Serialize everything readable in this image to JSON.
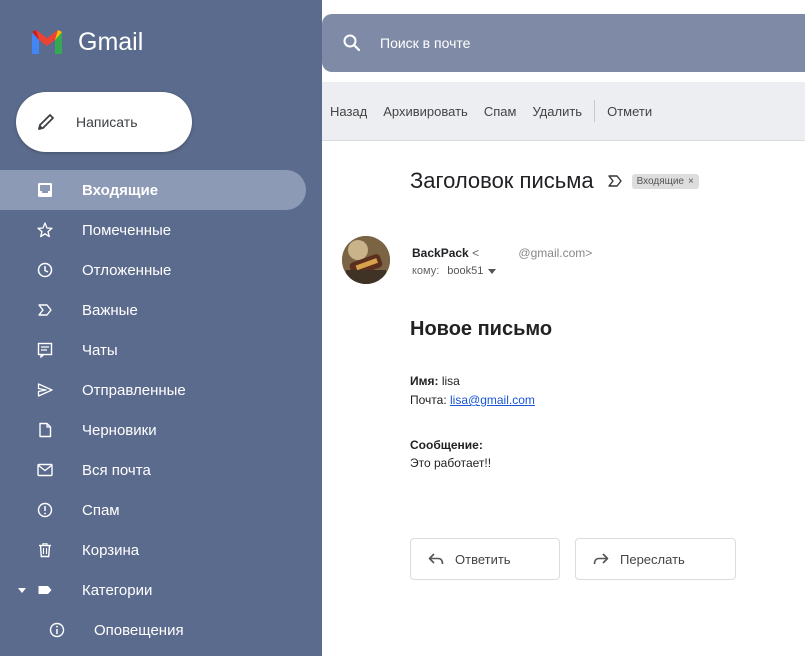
{
  "app": {
    "name": "Gmail",
    "colors": {
      "sidebar": "#5b6b8d",
      "active_item": "#8d9ab5",
      "search_bar": "#7f8ba6",
      "link": "#1a55d6"
    }
  },
  "compose": {
    "label": "Написать",
    "icon": "pencil-icon"
  },
  "search": {
    "placeholder": "Поиск в почте",
    "icon": "search-icon"
  },
  "sidebar": {
    "items": [
      {
        "label": "Входящие",
        "icon": "inbox-icon",
        "active": true
      },
      {
        "label": "Помеченные",
        "icon": "star-icon"
      },
      {
        "label": "Отложенные",
        "icon": "clock-icon"
      },
      {
        "label": "Важные",
        "icon": "important-icon"
      },
      {
        "label": "Чаты",
        "icon": "chat-icon"
      },
      {
        "label": "Отправленные",
        "icon": "send-icon"
      },
      {
        "label": "Черновики",
        "icon": "draft-icon"
      },
      {
        "label": "Вся почта",
        "icon": "all-mail-icon"
      },
      {
        "label": "Спам",
        "icon": "spam-icon"
      },
      {
        "label": "Корзина",
        "icon": "trash-icon"
      },
      {
        "label": "Категории",
        "icon": "label-icon",
        "expandable": true
      },
      {
        "label": "Оповещения",
        "icon": "info-icon",
        "sub": true
      }
    ]
  },
  "toolbar": {
    "back": "Назад",
    "archive": "Архивировать",
    "spam": "Спам",
    "delete": "Удалить",
    "mark": "Отмети"
  },
  "message": {
    "subject": "Заголовок письма",
    "label_chip": "Входящие",
    "chip_close": "×",
    "sender_name": "BackPack",
    "sender_open": "<",
    "sender_email_suffix": "@gmail.com>",
    "to_label": "кому:",
    "to_value": "book51",
    "body_title": "Новое письмо",
    "name_label": "Имя:",
    "name_value": "lisa",
    "email_label": "Почта:",
    "email_value": "lisa@gmail.com",
    "message_label": "Сообщение:",
    "message_value": "Это работает!!"
  },
  "actions": {
    "reply": "Ответить",
    "forward": "Переслать"
  }
}
